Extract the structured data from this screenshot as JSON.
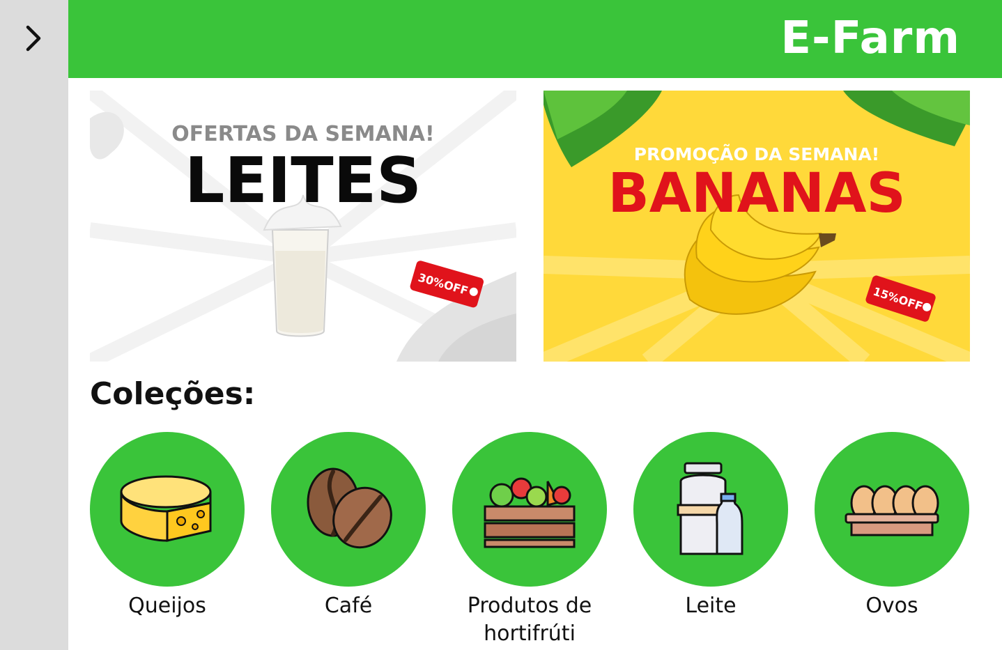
{
  "app": {
    "title": "E-Farm"
  },
  "sidebar": {
    "toggle_icon": "chevron-right-icon"
  },
  "banners": [
    {
      "subtitle": "OFERTAS DA SEMANA!",
      "title": "LEITES",
      "tag": "30%OFF"
    },
    {
      "subtitle": "PROMOÇÃO DA SEMANA!",
      "title": "BANANAS",
      "tag": "15%OFF"
    }
  ],
  "collections": {
    "title": "Coleções:",
    "items": [
      {
        "label": "Queijos",
        "icon": "cheese-icon"
      },
      {
        "label": "Café",
        "icon": "coffee-beans-icon"
      },
      {
        "label": "Produtos de hortifrúti",
        "icon": "vegetable-crate-icon"
      },
      {
        "label": "Leite",
        "icon": "milk-can-icon"
      },
      {
        "label": "Ovos",
        "icon": "eggs-icon"
      }
    ]
  },
  "colors": {
    "brand_green": "#3ac43a",
    "sidebar": "#dcdcdc",
    "tag_red": "#e0131b",
    "banana_yellow": "#ffd93a"
  }
}
